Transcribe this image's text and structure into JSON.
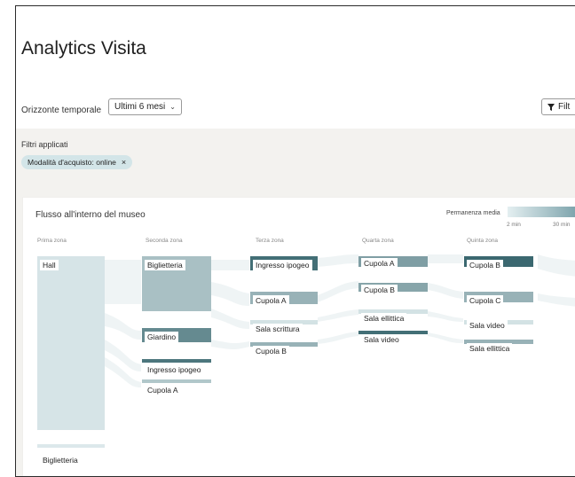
{
  "page": {
    "title": "Analytics Visita"
  },
  "toolbar": {
    "timeframe_label": "Orizzonte temporale",
    "timeframe_value": "Ultimi 6 mesi",
    "filter_label": "Filt"
  },
  "filters": {
    "title": "Filtri applicati",
    "chips": [
      {
        "label": "Modalità d'acquisto: online"
      }
    ]
  },
  "flow": {
    "title": "Flusso all'interno del museo",
    "legend": {
      "label": "Permanenza media",
      "min": "2 min",
      "max": "30 min"
    },
    "columns": [
      "Prima zona",
      "Seconda zona",
      "Terza zona",
      "Quarta zona",
      "Quinta zona"
    ],
    "nodes": [
      {
        "label": "Hall",
        "col": 0,
        "shade": 0.08
      },
      {
        "label": "Biglietteria",
        "col": 0,
        "shade": 0.05
      },
      {
        "label": "Biglietteria",
        "col": 1,
        "shade": 0.35
      },
      {
        "label": "Giardino",
        "col": 1,
        "shade": 0.75
      },
      {
        "label": "Ingresso ipogeo",
        "col": 1,
        "shade": 0.9
      },
      {
        "label": "Cupola A",
        "col": 1,
        "shade": 0.3
      },
      {
        "label": "Ingresso ipogeo",
        "col": 2,
        "shade": 0.95
      },
      {
        "label": "Cupola A",
        "col": 2,
        "shade": 0.45
      },
      {
        "label": "Sala scrittura",
        "col": 2,
        "shade": 0.1
      },
      {
        "label": "Cupola B",
        "col": 2,
        "shade": 0.45
      },
      {
        "label": "Cupola A",
        "col": 3,
        "shade": 0.6
      },
      {
        "label": "Cupola B",
        "col": 3,
        "shade": 0.55
      },
      {
        "label": "Sala ellittica",
        "col": 3,
        "shade": 0.1
      },
      {
        "label": "Sala video",
        "col": 3,
        "shade": 0.95
      },
      {
        "label": "Cupola B",
        "col": 4,
        "shade": 1.0
      },
      {
        "label": "Cupola C",
        "col": 4,
        "shade": 0.45
      },
      {
        "label": "Sala video",
        "col": 4,
        "shade": 0.1
      },
      {
        "label": "Sala ellittica",
        "col": 4,
        "shade": 0.45
      }
    ],
    "colors": {
      "light": "#e4eff1",
      "dark": "#3b6870"
    }
  }
}
